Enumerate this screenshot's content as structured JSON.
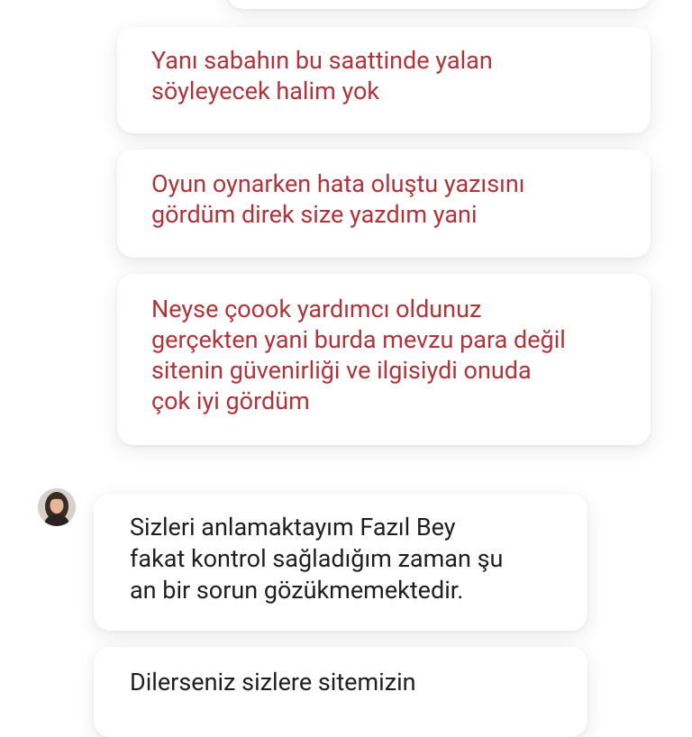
{
  "chat": {
    "user_messages": [
      {
        "text": "Yanı sabahın bu saattinde yalan\nsöyleyecek halim yok"
      },
      {
        "text": "Oyun oynarken hata oluştu yazısını\ngördüm direk size yazdım yani"
      },
      {
        "text": "Neyse çoook yardımcı oldunuz\ngerçekten yani burda mevzu para değil\nsitenin güvenirliği ve ilgisiydi onuda\nçok iyi gördüm"
      }
    ],
    "agent": {
      "avatar_icon": "agent-avatar-icon",
      "messages": [
        {
          "text": "Sizleri anlamaktayım Fazıl Bey\nfakat kontrol sağladığım zaman şu\nan bir sorun gözükmemektedir."
        },
        {
          "text": "Dilerseniz sizlere sitemizin"
        }
      ]
    }
  },
  "colors": {
    "user_text": "#b0343b",
    "agent_text": "#1f1f1f",
    "background": "#ffffff"
  }
}
